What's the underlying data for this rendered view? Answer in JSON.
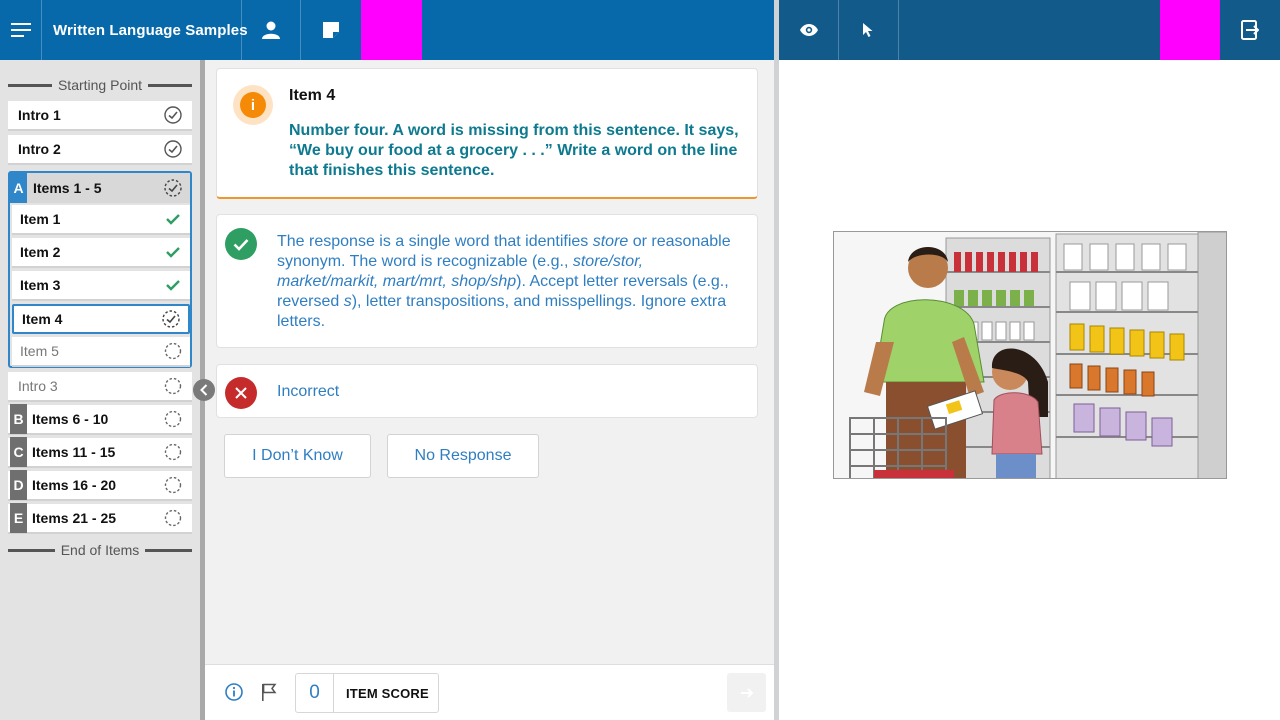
{
  "header": {
    "title": "Written Language Samples",
    "icons": [
      "menu-icon",
      "user-icon",
      "note-icon",
      "eye-icon",
      "pointer-icon",
      "exit-icon"
    ],
    "accent_colors": {
      "left_bar": "#0769aa",
      "right_bar": "#125a8a",
      "marker": "#ff00ff"
    }
  },
  "sidebar": {
    "start_label": "Starting Point",
    "end_label": "End of Items",
    "intro1": "Intro 1",
    "intro2": "Intro 2",
    "section_a": {
      "letter": "A",
      "label": "Items 1 - 5"
    },
    "items": [
      {
        "label": "Item 1",
        "status": "correct"
      },
      {
        "label": "Item 2",
        "status": "correct"
      },
      {
        "label": "Item 3",
        "status": "correct"
      },
      {
        "label": "Item 4",
        "status": "in-progress"
      },
      {
        "label": "Item 5",
        "status": "not-started"
      }
    ],
    "intro3": "Intro 3",
    "sections": [
      {
        "letter": "B",
        "label": "Items 6 - 10"
      },
      {
        "letter": "C",
        "label": "Items 11 - 15"
      },
      {
        "letter": "D",
        "label": "Items 16 - 20"
      },
      {
        "letter": "E",
        "label": "Items 21 - 25"
      }
    ]
  },
  "question": {
    "title": "Item 4",
    "text": "Number four. A word is missing from this sentence. It says, “We buy our food at a grocery . . .” Write a word on the line that finishes this sentence."
  },
  "responses": {
    "correct_parts": [
      "The response is a single word that identifies ",
      "store",
      " or reasonable synonym. The word is recognizable (e.g., ",
      "store/stor, market/markit, mart/mrt, shop/shp",
      "). Accept letter reversals (e.g., reversed ",
      "s",
      "), letter transpositions, and misspellings. Ignore extra letters."
    ],
    "incorrect": "Incorrect",
    "dont_know": "I Don’t Know",
    "no_response": "No Response"
  },
  "footer": {
    "score": "0",
    "score_label": "ITEM SCORE"
  }
}
